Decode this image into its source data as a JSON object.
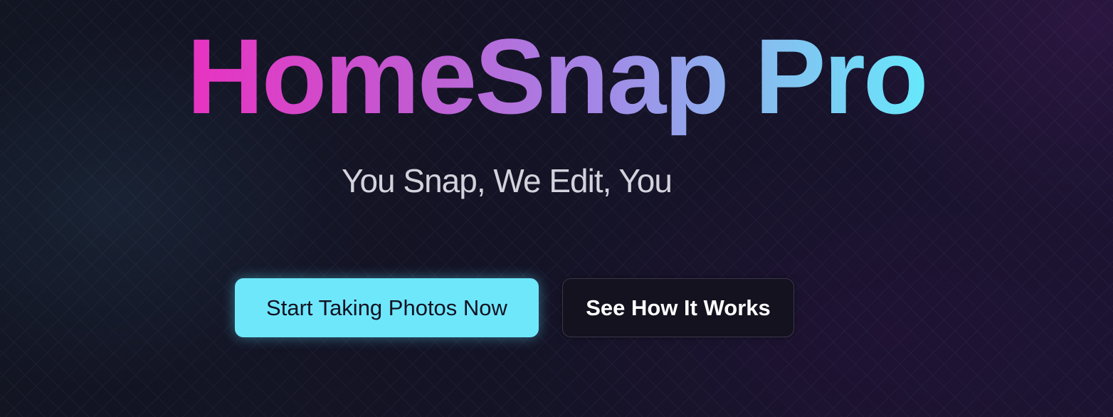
{
  "hero": {
    "title": "HomeSnap Pro",
    "subtitle": "You Snap, We Edit, You",
    "primary_button_label": "Start Taking Photos Now",
    "secondary_button_label": "See How It Works"
  },
  "colors": {
    "background": "#12101f",
    "title_gradient_start": "#e832c0",
    "title_gradient_end": "#66e8fb",
    "primary_button": "#6ee7fb",
    "secondary_button": "#15121f",
    "subtitle_text": "#d4d2dc"
  }
}
